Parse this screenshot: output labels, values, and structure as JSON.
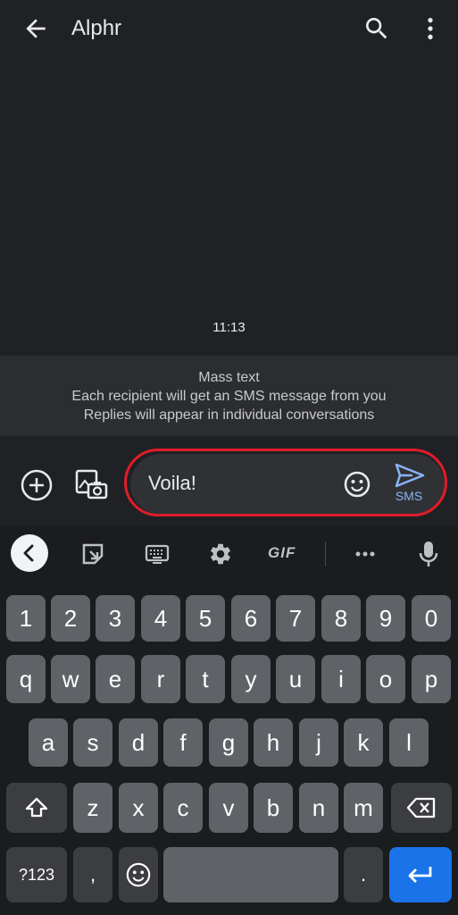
{
  "appbar": {
    "title": "Alphr",
    "back_icon": "arrow-back-icon",
    "search_icon": "search-icon",
    "more_icon": "more-vert-icon"
  },
  "conversation": {
    "timestamp": "11:13",
    "notice": {
      "title": "Mass text",
      "line1": "Each recipient will get an SMS message from you",
      "line2": "Replies will appear in individual conversations"
    }
  },
  "compose": {
    "text": "Voila!",
    "send_label": "SMS",
    "highlight_color": "#e11c2a",
    "accent_color": "#8ab4f8"
  },
  "keyboard": {
    "toolbar": [
      "collapse-icon",
      "sticker-icon",
      "keyboard-icon",
      "settings-icon",
      "GIF",
      "more-horiz-icon",
      "mic-icon"
    ],
    "row_numbers": [
      "1",
      "2",
      "3",
      "4",
      "5",
      "6",
      "7",
      "8",
      "9",
      "0"
    ],
    "row1": [
      "q",
      "w",
      "e",
      "r",
      "t",
      "y",
      "u",
      "i",
      "o",
      "p"
    ],
    "row2": [
      "a",
      "s",
      "d",
      "f",
      "g",
      "h",
      "j",
      "k",
      "l"
    ],
    "row3": [
      "z",
      "x",
      "c",
      "v",
      "b",
      "n",
      "m"
    ],
    "symbols_label": "?123",
    "comma": ",",
    "period": ".",
    "enter_color": "#1a73e8"
  }
}
